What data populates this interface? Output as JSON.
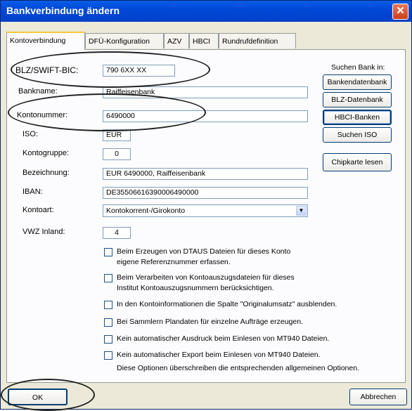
{
  "window": {
    "title": "Bankverbindung ändern",
    "close_glyph": "✕"
  },
  "tabs": [
    {
      "label": "Kontoverbindung"
    },
    {
      "label": "DFÜ-Konfiguration"
    },
    {
      "label": "AZV"
    },
    {
      "label": "HBCI"
    },
    {
      "label": "Rundrufdefinition"
    }
  ],
  "fields": {
    "blz_label": "BLZ/SWIFT-BIC:",
    "blz_value": "790 6XX XX",
    "bankname_label": "Bankname:",
    "bankname_value": "Raiffeisenbank",
    "kontonummer_label": "Kontonummer:",
    "kontonummer_value": "6490000",
    "iso_label": "ISO:",
    "iso_value": "EUR",
    "kontogruppe_label": "Kontogruppe:",
    "kontogruppe_value": "0",
    "bezeichnung_label": "Bezeichnung:",
    "bezeichnung_value": "EUR 6490000, Raiffeisenbank",
    "iban_label": "IBAN:",
    "iban_value": "DE35506616390006490000",
    "kontoart_label": "Kontoart:",
    "kontoart_value": "Kontokorrent-/Girokonto",
    "vwz_label": "VWZ Inland:",
    "vwz_value": "4"
  },
  "search": {
    "title": "Suchen Bank in:",
    "bankendatenbank": "Bankendatenbank",
    "blz_datenbank": "BLZ-Datenbank",
    "hbci_banken": "HBCI-Banken",
    "suchen_iso": "Suchen ISO",
    "chipkarte_lesen": "Chipkarte lesen"
  },
  "options": [
    {
      "line1": "Beim Erzeugen von DTAUS Dateien für dieses Konto",
      "line2": "eigene Referenznummer erfassen."
    },
    {
      "line1": "Beim Verarbeiten von Kontoauszugsdateien für dieses",
      "line2": "Institut Kontoauszugsnummern berücksichtigen."
    },
    {
      "line1": "In den Kontoinformationen die Spalte \"Originalumsatz\" ausblenden."
    },
    {
      "line1": "Bei Sammlern Plandaten für einzelne Aufträge erzeugen."
    },
    {
      "line1": "Kein automatischer Ausdruck beim Einlesen von MT940 Dateien."
    },
    {
      "line1": "Kein automatischer Export beim Einlesen von MT940 Dateien."
    }
  ],
  "options_note": "Diese Optionen überschreiben die entsprechenden allgemeinen Optionen.",
  "buttons": {
    "ok": "OK",
    "cancel": "Abbrechen"
  }
}
